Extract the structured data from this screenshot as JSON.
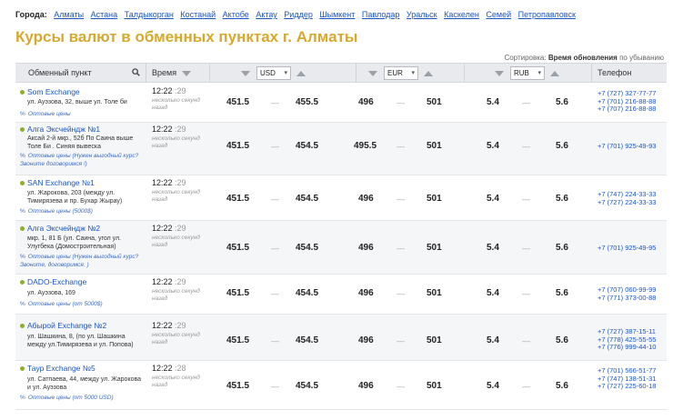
{
  "cities": {
    "label": "Города:",
    "items": [
      "Алматы",
      "Астана",
      "Талдыкорган",
      "Костанай",
      "Актобе",
      "Актау",
      "Риддер",
      "Шымкент",
      "Павлодар",
      "Уральск",
      "Каскелен",
      "Семей",
      "Петропавловск"
    ]
  },
  "title": "Курсы валют в обменных пунктах г. Алматы",
  "sort": {
    "label": "Сортировка:",
    "field": "Время обновления",
    "order": "по убыванию"
  },
  "header": {
    "col_point": "Обменный пункт",
    "col_time": "Время",
    "cur1": "USD",
    "cur2": "EUR",
    "cur3": "RUB",
    "col_phone": "Телефон"
  },
  "rows": [
    {
      "name": "Som Exchange",
      "addr": "ул. Ауэзова, 32, выше ул. Толе би",
      "note": "Оптовые цены",
      "time": "12:22",
      "sec": ":29",
      "ago": "несколько секунд назад",
      "usd_buy": "451.5",
      "usd_sell": "455.5",
      "eur_buy": "496",
      "eur_sell": "501",
      "rub_buy": "5.4",
      "rub_sell": "5.6",
      "phones": [
        "+7 (727) 327-77-77",
        "+7 (701) 216-88-88",
        "+7 (707) 216-88-88"
      ]
    },
    {
      "name": "Алга Эксчейндж №1",
      "addr": "Аксай 2-й мкр., 52б По Саина выше Толе Би . Синяя вывеска",
      "note": "Оптовые цены (Нужен выгодный курс? Звоните договоримся !)",
      "time": "12:22",
      "sec": ":29",
      "ago": "несколько секунд назад",
      "usd_buy": "451.5",
      "usd_sell": "454.5",
      "eur_buy": "495.5",
      "eur_sell": "501",
      "rub_buy": "5.4",
      "rub_sell": "5.6",
      "phones": [
        "+7 (701) 925-49-93"
      ]
    },
    {
      "name": "SAN Exchange №1",
      "addr": "ул. Жарокова, 203 (между ул. Тимирязева и пр. Бухар Жырау)",
      "note": "Оптовые цены (5000$)",
      "time": "12:22",
      "sec": ":29",
      "ago": "несколько секунд назад",
      "usd_buy": "451.5",
      "usd_sell": "454.5",
      "eur_buy": "496",
      "eur_sell": "501",
      "rub_buy": "5.4",
      "rub_sell": "5.6",
      "phones": [
        "+7 (747) 224-33-33",
        "+7 (727) 224-33-33"
      ]
    },
    {
      "name": "Алга Эксчейндж №2",
      "addr": "мкр. 1, 81 Б (ул. Саина, угол ул. Улугбека (Домостроительная)",
      "note": "Оптовые цены (Нужен выгодный курс? Звоните, договоримся. )",
      "time": "12:22",
      "sec": ":29",
      "ago": "несколько секунд назад",
      "usd_buy": "451.5",
      "usd_sell": "454.5",
      "eur_buy": "496",
      "eur_sell": "501",
      "rub_buy": "5.4",
      "rub_sell": "5.6",
      "phones": [
        "+7 (701) 925-49-95"
      ]
    },
    {
      "name": "DADO-Exchange",
      "addr": "ул. Ауэзова, 169",
      "note": "Оптовые цены (от 5000$)",
      "time": "12:22",
      "sec": ":29",
      "ago": "несколько секунд назад",
      "usd_buy": "451.5",
      "usd_sell": "454.5",
      "eur_buy": "496",
      "eur_sell": "501",
      "rub_buy": "5.4",
      "rub_sell": "5.6",
      "phones": [
        "+7 (707) 060-99-99",
        "+7 (771) 373-00-88"
      ]
    },
    {
      "name": "Абырой Exchange №2",
      "addr": "ул. Шашкина, 8, (по ул. Шашкина между ул.Тимирязева и ул. Попова)",
      "note": "",
      "time": "12:22",
      "sec": ":29",
      "ago": "несколько секунд назад",
      "usd_buy": "451.5",
      "usd_sell": "454.5",
      "eur_buy": "496",
      "eur_sell": "501",
      "rub_buy": "5.4",
      "rub_sell": "5.6",
      "phones": [
        "+7 (727) 387-15-11",
        "+7 (778) 425-55-55",
        "+7 (776) 999-44-10"
      ]
    },
    {
      "name": "Таур Exchange №5",
      "addr": "ул. Сатпаева, 44, между ул. Жарокова и ул. Ауэзова",
      "note": "Оптовые цены (от 5000 USD)",
      "time": "12:22",
      "sec": ":28",
      "ago": "несколько секунд назад",
      "usd_buy": "451.5",
      "usd_sell": "454.5",
      "eur_buy": "496",
      "eur_sell": "501",
      "rub_buy": "5.4",
      "rub_sell": "5.6",
      "phones": [
        "+7 (701) 566-51-77",
        "+7 (747) 138-51-31",
        "+7 (727) 225-60-18"
      ]
    }
  ]
}
